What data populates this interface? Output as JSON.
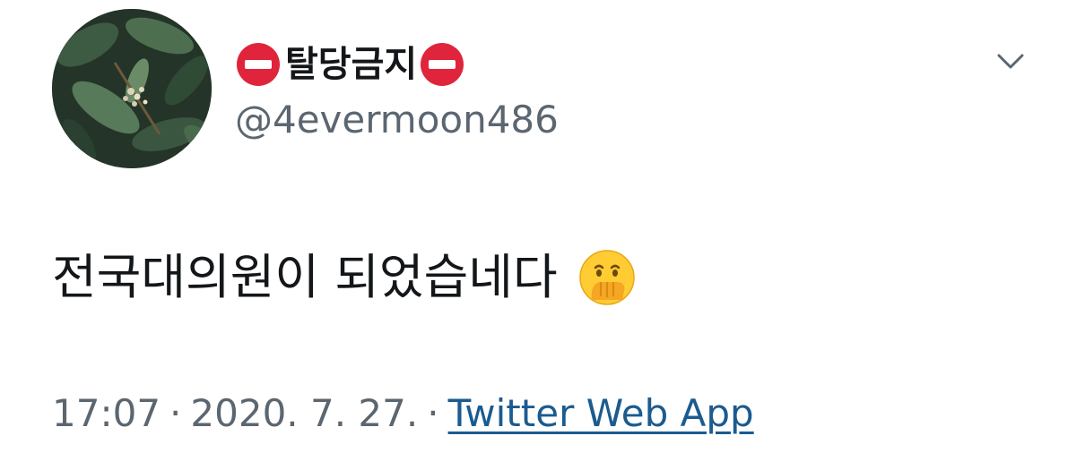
{
  "author": {
    "display_name": "탈당금지",
    "name_prefix_icon": "no-entry-icon",
    "name_suffix_icon": "no-entry-icon",
    "handle": "@4evermoon486",
    "avatar_icon": "leafy-branch-avatar"
  },
  "tweet": {
    "text": "전국대의원이 되었습네다",
    "emoji_icon": "face-with-hand-over-mouth-icon"
  },
  "meta": {
    "time": "17:07",
    "separator": "·",
    "date": "2020. 7. 27.",
    "source": "Twitter Web App"
  },
  "menu": {
    "caret_icon": "chevron-down-icon"
  },
  "colors": {
    "text": "#14171a",
    "secondary": "#5b6670",
    "link": "#1b5b8f",
    "no_entry_red": "#e0243c"
  }
}
